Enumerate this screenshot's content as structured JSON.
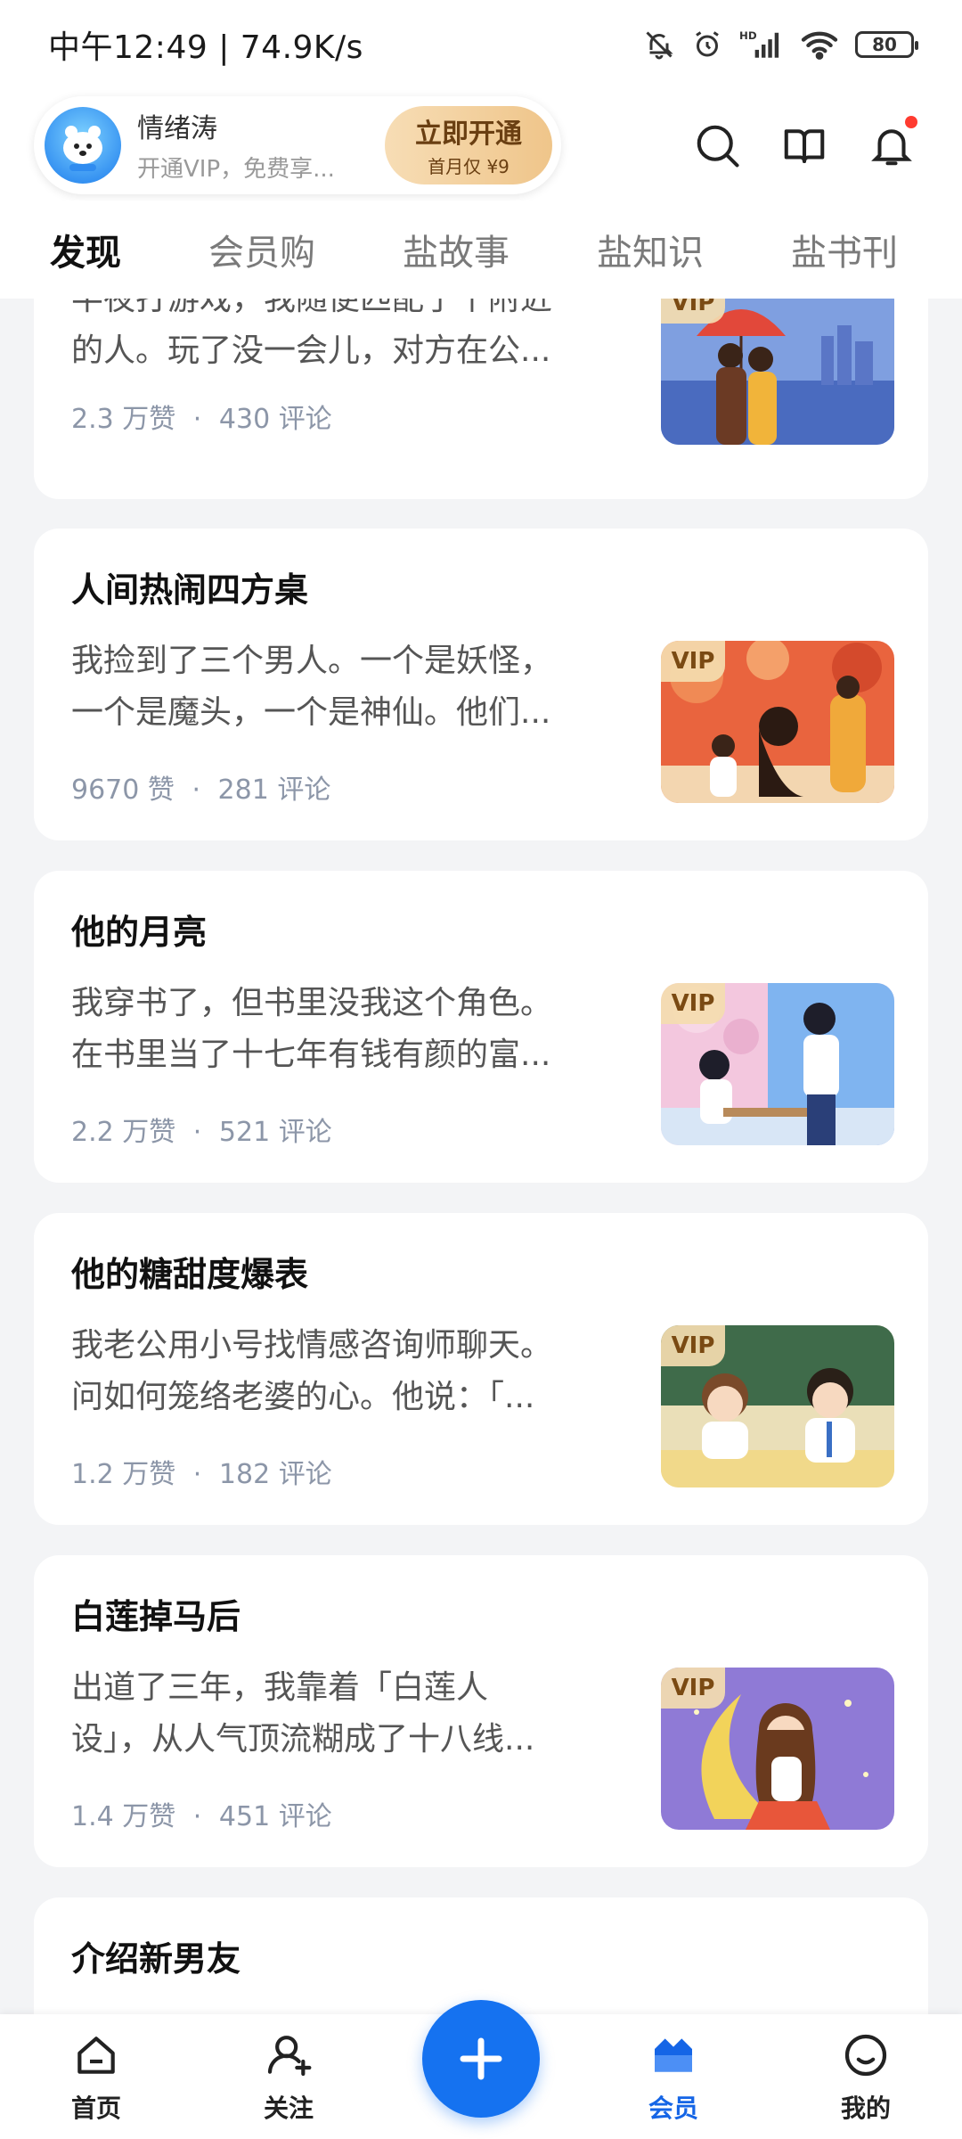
{
  "status_bar": {
    "time_speed": "中午12:49 | 74.9K/s",
    "battery": "80"
  },
  "header": {
    "user_name": "情绪涛",
    "user_sub": "开通VIP，免费享...",
    "vip_button_main": "立即开通",
    "vip_button_sub": "首月仅 ¥9"
  },
  "tabs": [
    "发现",
    "会员购",
    "盐故事",
    "盐知识",
    "盐书刊"
  ],
  "cards": [
    {
      "title": "",
      "excerpt_line1": "半夜打游戏，我随便匹配了个附近",
      "excerpt_line2": "的人。玩了没一会儿，对方在公...",
      "likes": "2.3 万赞",
      "comments": "430 评论",
      "vip_tag": "VIP"
    },
    {
      "title": "人间热闹四方桌",
      "excerpt_line1": "我捡到了三个男人。一个是妖怪，",
      "excerpt_line2": "一个是魔头，一个是神仙。他们...",
      "likes": "9670 赞",
      "comments": "281 评论",
      "vip_tag": "VIP"
    },
    {
      "title": "他的月亮",
      "excerpt_line1": "我穿书了，但书里没我这个角色。",
      "excerpt_line2": "在书里当了十七年有钱有颜的富...",
      "likes": "2.2 万赞",
      "comments": "521 评论",
      "vip_tag": "VIP"
    },
    {
      "title": "他的糖甜度爆表",
      "excerpt_line1": "我老公用小号找情感咨询师聊天。",
      "excerpt_line2": "问如何笼络老婆的心。他说：「...",
      "likes": "1.2 万赞",
      "comments": "182 评论",
      "vip_tag": "VIP"
    },
    {
      "title": "白莲掉马后",
      "excerpt_line1": "出道了三年，我靠着「白莲人",
      "excerpt_line2": "设」，从人气顶流糊成了十八线...",
      "likes": "1.4 万赞",
      "comments": "451 评论",
      "vip_tag": "VIP"
    },
    {
      "title": "介绍新男友"
    }
  ],
  "stat_separator": "·",
  "bottom_nav": {
    "home": "首页",
    "follow": "关注",
    "member": "会员",
    "mine": "我的"
  },
  "colors": {
    "accent": "#1565e6",
    "vip_gold": "#efc58a",
    "background": "#f3f4f6",
    "stats_text": "#8c96a8"
  }
}
